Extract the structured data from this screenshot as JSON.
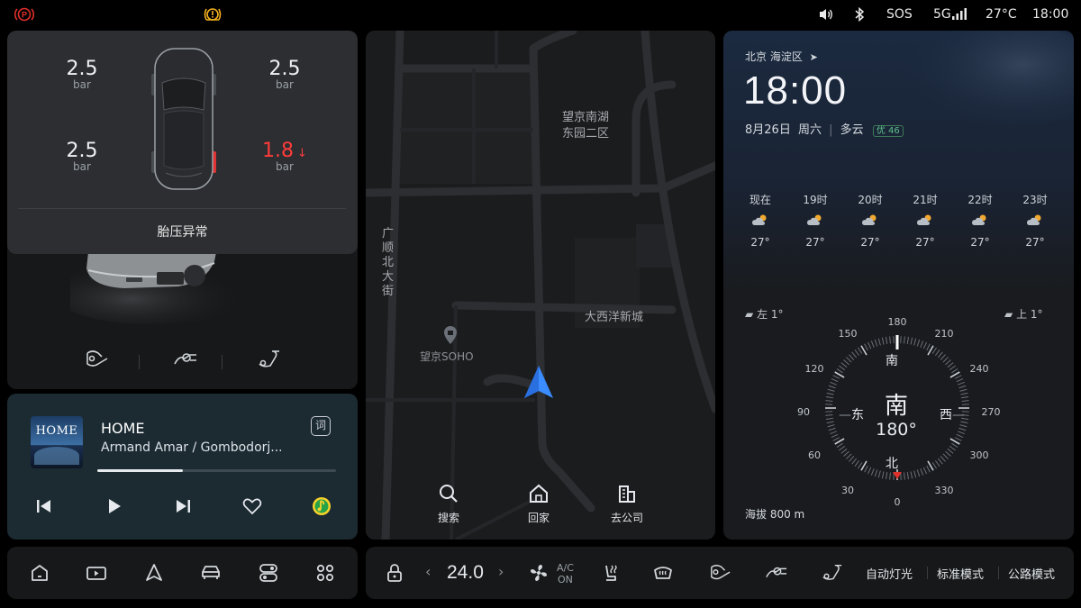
{
  "status_bar": {
    "volume_icon": "volume-icon",
    "bluetooth_icon": "bluetooth-icon",
    "sos": "SOS",
    "network": "5G",
    "temperature": "27°C",
    "time": "18:00",
    "colors": {
      "parking_brake": "#e0302a",
      "warning": "#f2b01e"
    }
  },
  "tire_pressure": {
    "front_left": {
      "value": "2.5",
      "unit": "bar"
    },
    "front_right": {
      "value": "2.5",
      "unit": "bar"
    },
    "rear_left": {
      "value": "2.5",
      "unit": "bar"
    },
    "rear_right": {
      "value": "1.8",
      "unit": "bar",
      "alert": true
    },
    "status": "胎压异常",
    "alert_color": "#ff3b3b"
  },
  "music": {
    "album_text": "HOME",
    "title": "HOME",
    "artist": "Armand Amar / Gombodorj...",
    "lyric_label": "词",
    "progress": 0.36
  },
  "map": {
    "labels": {
      "area1": "望京南湖\n东园二区",
      "street": "广\n顺\n北\n大\n街",
      "poi": "望京SOHO",
      "area2": "大西洋新城"
    },
    "buttons": [
      {
        "label": "搜索",
        "icon": "search-icon"
      },
      {
        "label": "回家",
        "icon": "home-icon"
      },
      {
        "label": "去公司",
        "icon": "office-icon"
      }
    ]
  },
  "weather": {
    "location": "北京 海淀区",
    "time": "18:00",
    "date": "8月26日",
    "weekday": "周六",
    "condition": "多云",
    "aqi": "优 46",
    "hourly": [
      {
        "time": "现在",
        "temp": "27°"
      },
      {
        "time": "19时",
        "temp": "27°"
      },
      {
        "time": "20时",
        "temp": "27°"
      },
      {
        "time": "21时",
        "temp": "27°"
      },
      {
        "time": "22时",
        "temp": "27°"
      },
      {
        "time": "23时",
        "temp": "27°"
      }
    ],
    "tilt_left": "左 1°",
    "tilt_up": "上 1°"
  },
  "compass": {
    "heading_label": "南",
    "heading": "180°",
    "top": "南",
    "left": "东",
    "right": "西",
    "bottom": "北",
    "ticks": {
      "t180": "180",
      "t210": "210",
      "t240": "240",
      "t270": "270",
      "t300": "300",
      "t330": "330",
      "t0": "0",
      "t30": "30",
      "t60": "60",
      "t90": "90",
      "t120": "120",
      "t150": "150"
    },
    "altitude": "海拔 800 m",
    "needle_color": "#e0302a"
  },
  "dock_left": {
    "icons": [
      "home-icon",
      "media-icon",
      "navigation-icon",
      "car-icon",
      "toggle-icon",
      "apps-icon"
    ]
  },
  "dock_right": {
    "temperature": "24.0",
    "ac_label": "A/C",
    "ac_state": "ON",
    "modes": [
      "自动灯光",
      "标准模式",
      "公路模式"
    ]
  }
}
